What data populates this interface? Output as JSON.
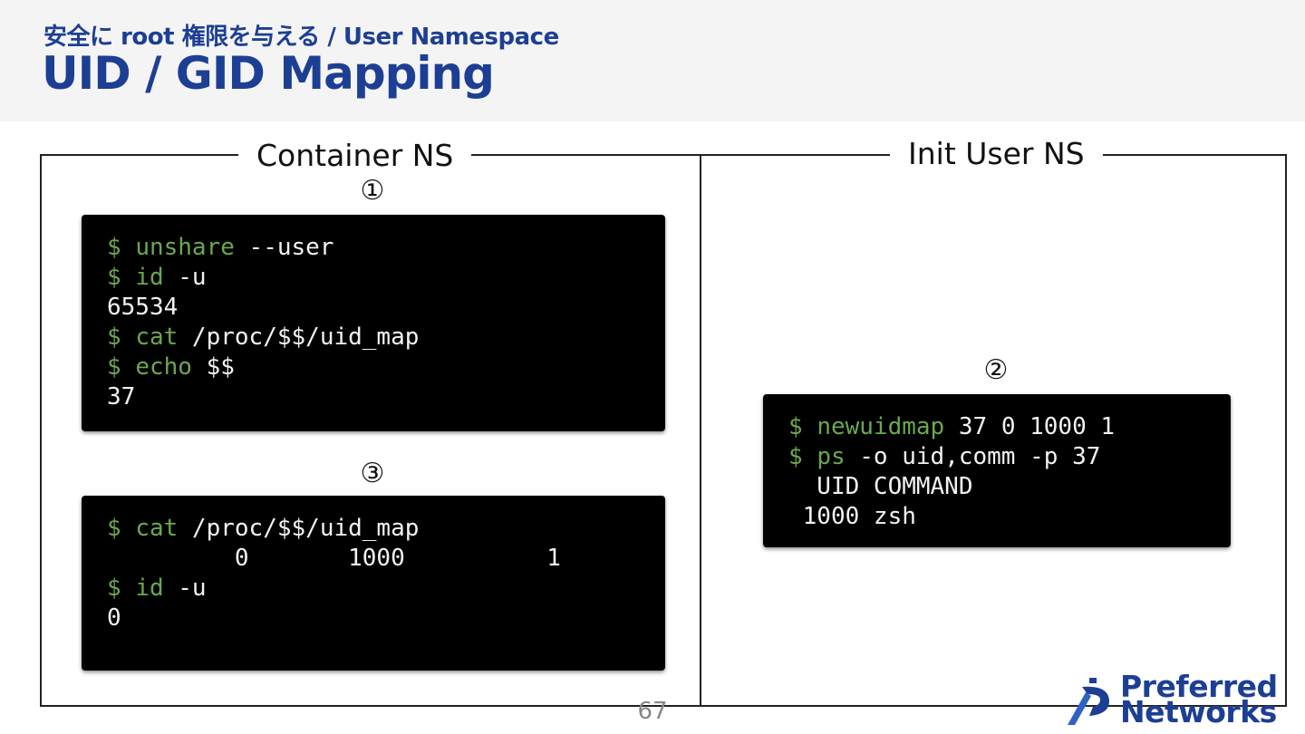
{
  "header": {
    "subtitle": "安全に root 権限を与える / User Namespace",
    "title": "UID / GID Mapping"
  },
  "left_panel": {
    "label": "Container NS"
  },
  "right_panel": {
    "label": "Init User NS"
  },
  "steps": {
    "one": "①",
    "two": "②",
    "three": "③"
  },
  "terminal_1": {
    "lines": [
      {
        "prompt": "$",
        "cmd": "unshare",
        "args": " --user"
      },
      {
        "prompt": "$",
        "cmd": "id",
        "args": " -u"
      },
      {
        "output": "65534"
      },
      {
        "prompt": "$",
        "cmd": "cat",
        "args": " /proc/$$/uid_map"
      },
      {
        "prompt": "$",
        "cmd": "echo",
        "args": " $$"
      },
      {
        "output": "37"
      }
    ]
  },
  "terminal_2": {
    "lines": [
      {
        "prompt": "$",
        "cmd": "newuidmap",
        "args": " 37 0 1000 1"
      },
      {
        "prompt": "$",
        "cmd": "ps",
        "args": " -o uid,comm -p 37"
      },
      {
        "output": "  UID COMMAND"
      },
      {
        "output": " 1000 zsh"
      }
    ]
  },
  "terminal_3": {
    "lines": [
      {
        "prompt": "$",
        "cmd": "cat",
        "args": " /proc/$$/uid_map"
      },
      {
        "output": "         0       1000          1"
      },
      {
        "prompt": "$",
        "cmd": "id",
        "args": " -u"
      },
      {
        "output": "0"
      }
    ]
  },
  "footer": {
    "page_number": "67",
    "logo_line1": "Preferred",
    "logo_line2": "Networks"
  },
  "colors": {
    "brand": "#1d3f93",
    "prompt": "#6aa84f",
    "terminal_bg": "#000000"
  }
}
